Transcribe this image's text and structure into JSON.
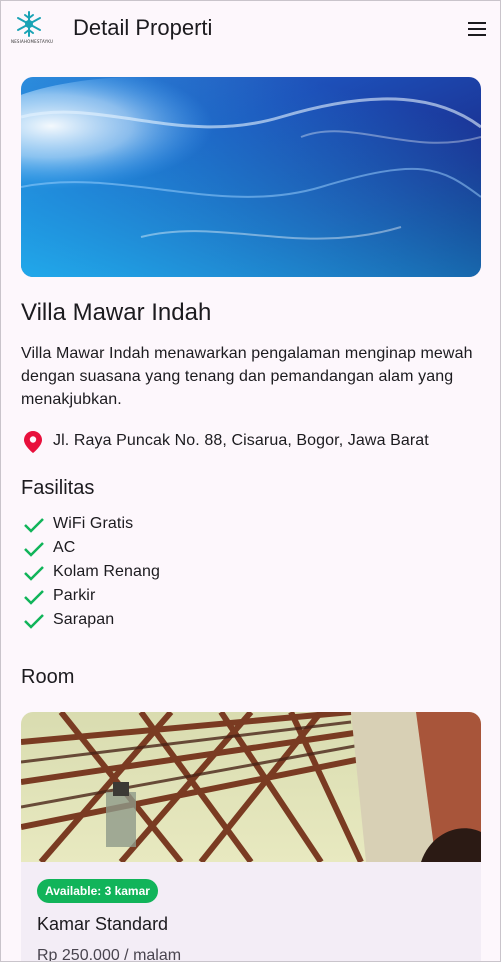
{
  "appbar": {
    "title": "Detail Properti",
    "logo_text": "NESIAHOMESTAYKU",
    "menu_icon": "hamburger-menu-icon"
  },
  "property": {
    "name": "Villa Mawar Indah",
    "description": "Villa Mawar Indah menawarkan pengalaman menginap mewah dengan suasana yang tenang dan pemandangan alam yang menakjubkan.",
    "address": "Jl. Raya Puncak No. 88, Cisarua, Bogor, Jawa Barat",
    "address_icon": "location-pin-icon",
    "image_icon": "ocean-wave-photo"
  },
  "facilities": {
    "title": "Fasilitas",
    "items": [
      "WiFi Gratis",
      "AC",
      "Kolam Renang",
      "Parkir",
      "Sarapan"
    ]
  },
  "rooms": {
    "title": "Room",
    "items": [
      {
        "availability": "Available: 3 kamar",
        "name": "Kamar Standard",
        "price": "Rp 250.000 / malam"
      }
    ]
  },
  "colors": {
    "background": "#fdf7fc",
    "accent_check": "#11b45a",
    "pin": "#e8103c",
    "badge": "#11b45a",
    "card": "#f3edf6"
  }
}
